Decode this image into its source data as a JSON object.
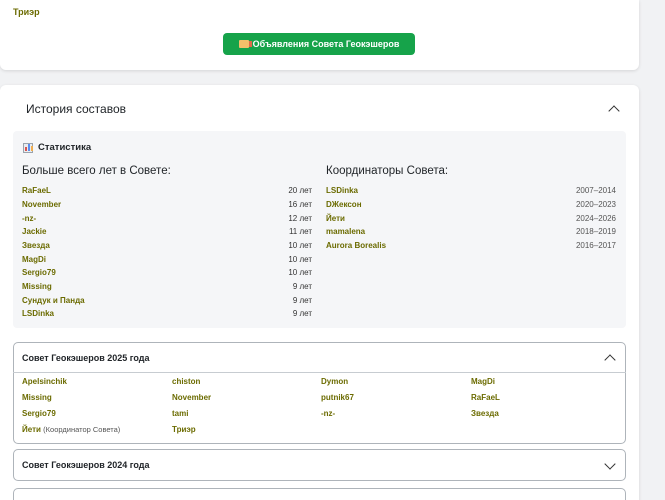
{
  "top": {
    "trier": "Триэр",
    "announce_btn": "Объявления Совета Геокэшеров"
  },
  "history": {
    "title": "История составов",
    "stats_title": "Статистика",
    "left_head": "Больше всего лет в Совете:",
    "right_head": "Координаторы Совета:",
    "most_years": [
      {
        "name": "RaFaeL",
        "value": "20 лет"
      },
      {
        "name": "November",
        "value": "16 лет"
      },
      {
        "name": "-nz-",
        "value": "12 лет"
      },
      {
        "name": "Jackie",
        "value": "11 лет"
      },
      {
        "name": "Звезда",
        "value": "10 лет"
      },
      {
        "name": "MagDi",
        "value": "10 лет"
      },
      {
        "name": "Sergio79",
        "value": "10 лет"
      },
      {
        "name": "Missing",
        "value": "9 лет"
      },
      {
        "name": "Сундук и Панда",
        "value": "9 лет"
      },
      {
        "name": "LSDinka",
        "value": "9 лет"
      }
    ],
    "coordinators": [
      {
        "name": "LSDinka",
        "years": "2007–2014"
      },
      {
        "name": "DЖексон",
        "years": "2020–2023"
      },
      {
        "name": "Йети",
        "years": "2024–2026"
      },
      {
        "name": "mamalena",
        "years": "2018–2019"
      },
      {
        "name": "Aurora Borealis",
        "years": "2016–2017"
      }
    ]
  },
  "council2025": {
    "title": "Совет Геокэшеров 2025 года",
    "rows": [
      [
        "Apelsinchik",
        "chiston",
        "Dymon",
        "MagDi"
      ],
      [
        "Missing",
        "November",
        "putnik67",
        "RaFaeL"
      ],
      [
        "Sergio79",
        "tami",
        "-nz-",
        "Звезда"
      ]
    ],
    "last_row": {
      "yeti": "Йети",
      "yeti_note": "(Координатор Совета)",
      "trier": "Триэр"
    }
  },
  "council2024": {
    "title": "Совет Геокэшеров 2024 года"
  }
}
